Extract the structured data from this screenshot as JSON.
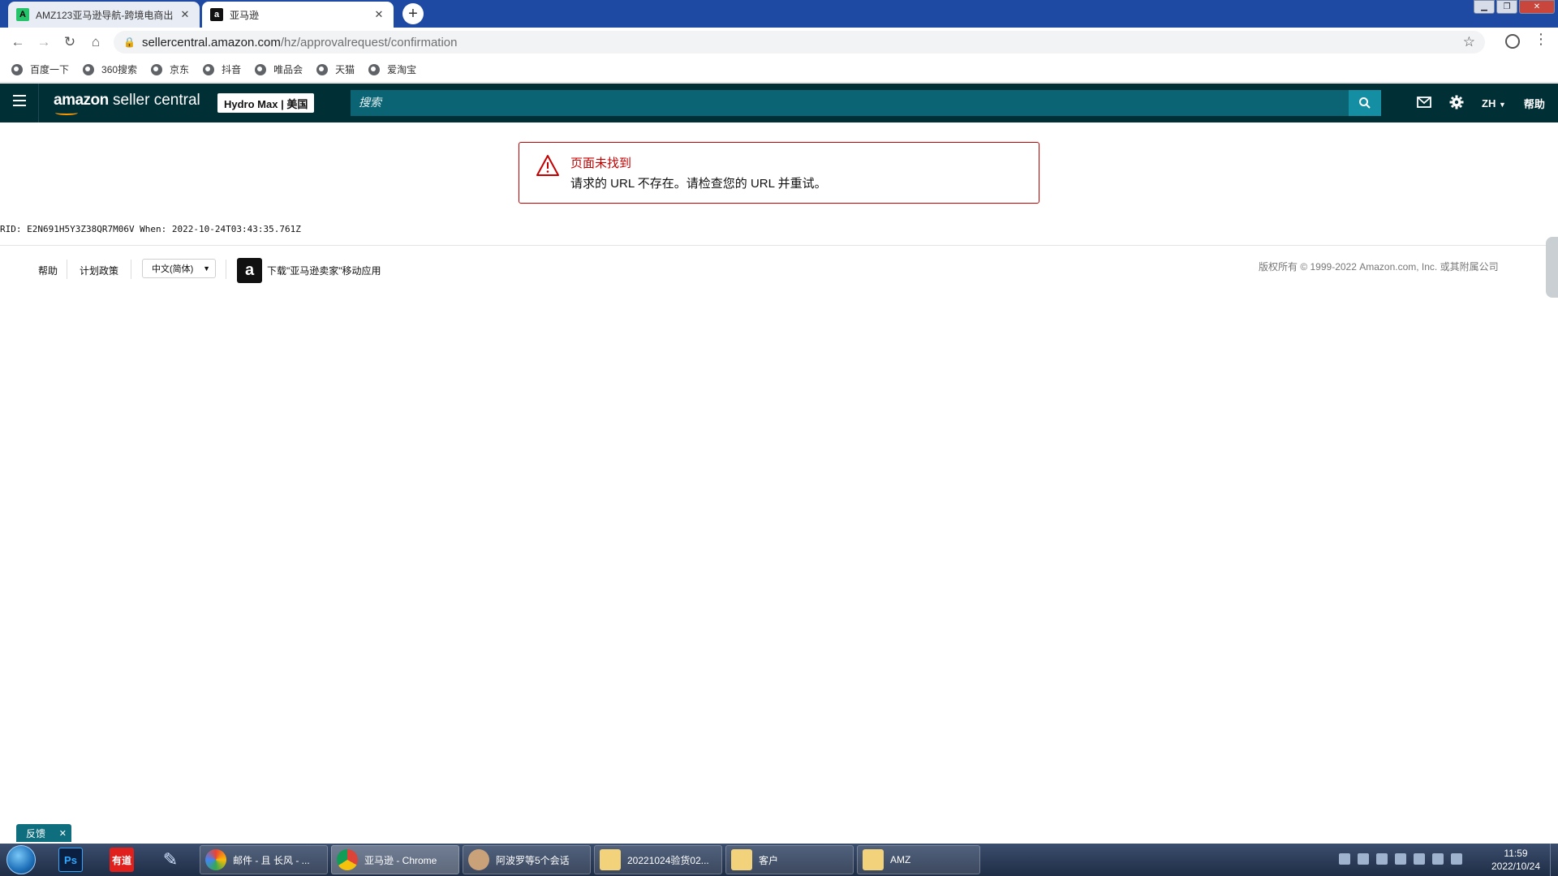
{
  "browser": {
    "tabs": [
      {
        "title": "AMZ123亚马逊导航-跨境电商出",
        "favicon": "A"
      },
      {
        "title": "亚马逊",
        "favicon": "a"
      }
    ],
    "url_host": "sellercentral.amazon.com",
    "url_path": "/hz/approvalrequest/confirmation",
    "bookmarks": [
      "百度一下",
      "360搜索",
      "京东",
      "抖音",
      "唯品会",
      "天猫",
      "爱淘宝"
    ]
  },
  "header": {
    "logo_amazon": "amazon",
    "logo_rest": "seller central",
    "store": "Hydro Max | 美国",
    "search_placeholder": "搜索",
    "language": "ZH",
    "help": "帮助"
  },
  "alert": {
    "title": "页面未找到",
    "message": "请求的 URL 不存在。请检查您的 URL 并重试。"
  },
  "rid_line": "RID: E2N691H5Y3Z38QR7M06V When: 2022-10-24T03:43:35.761Z",
  "footer": {
    "help": "帮助",
    "policies": "计划政策",
    "language_select": "中文(简体)",
    "app_link": "下载\"亚马逊卖家\"移动应用",
    "copyright": "版权所有 © 1999-2022 Amazon.com, Inc. 或其附属公司"
  },
  "feedback": {
    "label": "反馈"
  },
  "taskbar": {
    "pinned": [
      "Ps",
      "有道"
    ],
    "buttons": [
      "邮件 - 且 长风 - ...",
      "亚马逊 - Chrome",
      "阿波罗等5个会话",
      "20221024验货02...",
      "客户",
      "AMZ"
    ],
    "time": "11:59",
    "date": "2022/10/24"
  },
  "colors": {
    "header_bg": "#002f36",
    "search_bg": "#0b6474",
    "search_btn": "#138ea3",
    "alert_red": "#c40000",
    "feedback_bg": "#0f6e7e"
  }
}
